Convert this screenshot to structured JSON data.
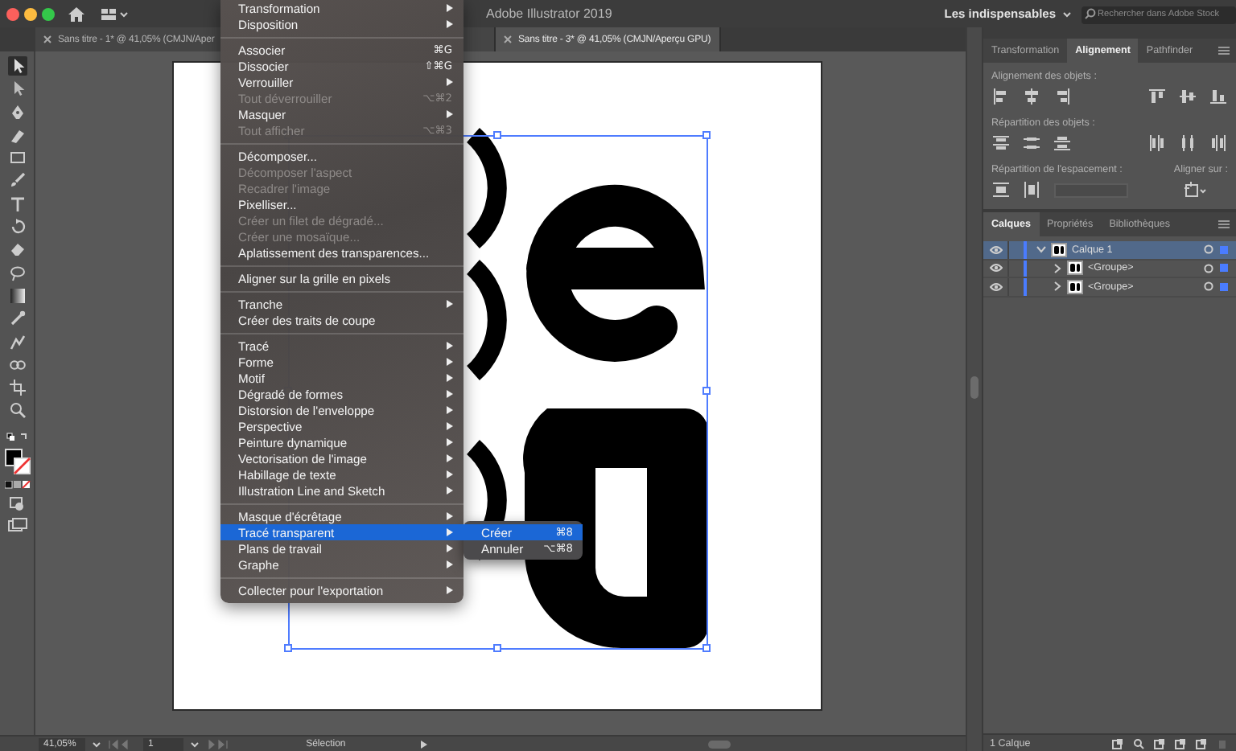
{
  "window": {
    "title": "Adobe Illustrator 2019"
  },
  "workspace": {
    "label": "Les indispensables"
  },
  "stock_search": {
    "placeholder": "Rechercher dans Adobe Stock"
  },
  "document_tabs": [
    {
      "label": "Sans titre - 1* @ 41,05% (CMJN/Aper",
      "selected": false
    },
    {
      "label": "Sans titre - 3* @ 41,05% (CMJN/Aperçu GPU)",
      "selected": true
    }
  ],
  "toolbar": {
    "tools": [
      {
        "kind": "selection",
        "selected": true
      },
      {
        "kind": "direct-selection",
        "selected": false
      },
      {
        "kind": "pen",
        "selected": false
      },
      {
        "kind": "shaper",
        "selected": false
      },
      {
        "kind": "rectangle",
        "selected": false
      },
      {
        "kind": "brush",
        "selected": false
      },
      {
        "kind": "type",
        "selected": false
      },
      {
        "kind": "rotate",
        "selected": false
      },
      {
        "kind": "eraser",
        "selected": false
      },
      {
        "kind": "lasso",
        "selected": false
      },
      {
        "kind": "gradient",
        "selected": false
      },
      {
        "kind": "eyedropper",
        "selected": false
      },
      {
        "kind": "blend",
        "selected": false
      },
      {
        "kind": "symbol",
        "selected": false
      },
      {
        "kind": "artboard",
        "selected": false
      },
      {
        "kind": "zoom",
        "selected": false
      },
      {
        "kind": "swap",
        "selected": false
      },
      {
        "kind": "fill-stroke",
        "selected": false
      },
      {
        "kind": "color-mode",
        "selected": false
      },
      {
        "kind": "draw-mode",
        "selected": false
      },
      {
        "kind": "screen-mode",
        "selected": false
      }
    ]
  },
  "menu": {
    "items": [
      {
        "kind": "item",
        "label": "Transformation",
        "submenu": true,
        "disabled": false,
        "selected": false
      },
      {
        "kind": "item",
        "label": "Disposition",
        "submenu": true,
        "disabled": false,
        "selected": false
      },
      {
        "kind": "separator"
      },
      {
        "kind": "item",
        "label": "Associer",
        "shortcut": "⌘G",
        "submenu": false,
        "disabled": false,
        "selected": false
      },
      {
        "kind": "item",
        "label": "Dissocier",
        "shortcut": "⇧⌘G",
        "submenu": false,
        "disabled": false,
        "selected": false
      },
      {
        "kind": "item",
        "label": "Verrouiller",
        "submenu": true,
        "disabled": false,
        "selected": false
      },
      {
        "kind": "item",
        "label": "Tout déverrouiller",
        "shortcut": "⌥⌘2",
        "submenu": false,
        "disabled": true,
        "selected": false
      },
      {
        "kind": "item",
        "label": "Masquer",
        "submenu": true,
        "disabled": false,
        "selected": false
      },
      {
        "kind": "item",
        "label": "Tout afficher",
        "shortcut": "⌥⌘3",
        "submenu": false,
        "disabled": true,
        "selected": false
      },
      {
        "kind": "separator"
      },
      {
        "kind": "item",
        "label": "Décomposer...",
        "submenu": false,
        "disabled": false,
        "selected": false
      },
      {
        "kind": "item",
        "label": "Décomposer l'aspect",
        "submenu": false,
        "disabled": true,
        "selected": false
      },
      {
        "kind": "item",
        "label": "Recadrer l'image",
        "submenu": false,
        "disabled": true,
        "selected": false
      },
      {
        "kind": "item",
        "label": "Pixelliser...",
        "submenu": false,
        "disabled": false,
        "selected": false
      },
      {
        "kind": "item",
        "label": "Créer un filet de dégradé...",
        "submenu": false,
        "disabled": true,
        "selected": false
      },
      {
        "kind": "item",
        "label": "Créer une mosaïque...",
        "submenu": false,
        "disabled": true,
        "selected": false
      },
      {
        "kind": "item",
        "label": "Aplatissement des transparences...",
        "submenu": false,
        "disabled": false,
        "selected": false
      },
      {
        "kind": "separator"
      },
      {
        "kind": "item",
        "label": "Aligner sur la grille en pixels",
        "submenu": false,
        "disabled": false,
        "selected": false
      },
      {
        "kind": "separator"
      },
      {
        "kind": "item",
        "label": "Tranche",
        "submenu": true,
        "disabled": false,
        "selected": false
      },
      {
        "kind": "item",
        "label": "Créer des traits de coupe",
        "submenu": false,
        "disabled": false,
        "selected": false
      },
      {
        "kind": "separator"
      },
      {
        "kind": "item",
        "label": "Tracé",
        "submenu": true,
        "disabled": false,
        "selected": false
      },
      {
        "kind": "item",
        "label": "Forme",
        "submenu": true,
        "disabled": false,
        "selected": false
      },
      {
        "kind": "item",
        "label": "Motif",
        "submenu": true,
        "disabled": false,
        "selected": false
      },
      {
        "kind": "item",
        "label": "Dégradé de formes",
        "submenu": true,
        "disabled": false,
        "selected": false
      },
      {
        "kind": "item",
        "label": "Distorsion de l'enveloppe",
        "submenu": true,
        "disabled": false,
        "selected": false
      },
      {
        "kind": "item",
        "label": "Perspective",
        "submenu": true,
        "disabled": false,
        "selected": false
      },
      {
        "kind": "item",
        "label": "Peinture dynamique",
        "submenu": true,
        "disabled": false,
        "selected": false
      },
      {
        "kind": "item",
        "label": "Vectorisation de l'image",
        "submenu": true,
        "disabled": false,
        "selected": false
      },
      {
        "kind": "item",
        "label": "Habillage de texte",
        "submenu": true,
        "disabled": false,
        "selected": false
      },
      {
        "kind": "item",
        "label": "Illustration Line and Sketch",
        "submenu": true,
        "disabled": false,
        "selected": false
      },
      {
        "kind": "separator"
      },
      {
        "kind": "item",
        "label": "Masque d'écrêtage",
        "submenu": true,
        "disabled": false,
        "selected": false
      },
      {
        "kind": "item",
        "label": "Tracé transparent",
        "submenu": true,
        "disabled": false,
        "selected": true,
        "submenu_items": [
          {
            "label": "Créer",
            "shortcut": "⌘8",
            "selected": true
          },
          {
            "label": "Annuler",
            "shortcut": "⌥⌘8",
            "selected": false
          }
        ]
      },
      {
        "kind": "item",
        "label": "Plans de travail",
        "submenu": true,
        "disabled": false,
        "selected": false
      },
      {
        "kind": "item",
        "label": "Graphe",
        "submenu": true,
        "disabled": false,
        "selected": false
      },
      {
        "kind": "separator"
      },
      {
        "kind": "item",
        "label": "Collecter pour l'exportation",
        "submenu": true,
        "disabled": false,
        "selected": false
      }
    ]
  },
  "align_panel": {
    "tabs": [
      {
        "label": "Transformation",
        "selected": false
      },
      {
        "label": "Alignement",
        "selected": true
      },
      {
        "label": "Pathfinder",
        "selected": false
      }
    ],
    "sections": [
      "Alignement des objets :",
      "Répartition des objets :",
      "Répartition de l'espacement :"
    ],
    "align_to": "Aligner sur :"
  },
  "layers_panel": {
    "tabs": [
      {
        "label": "Calques",
        "selected": true
      },
      {
        "label": "Propriétés",
        "selected": false
      },
      {
        "label": "Bibliothèques",
        "selected": false
      }
    ],
    "layers": [
      {
        "name": "Calque 1",
        "expanded": true,
        "selected": true,
        "children": [
          {
            "name": "<Groupe>",
            "expanded": false,
            "selected": false
          },
          {
            "name": "<Groupe>",
            "expanded": false,
            "selected": false
          }
        ]
      }
    ],
    "footer": "1 Calque"
  },
  "status_bar": {
    "zoom": "41,05%",
    "artboard_number": "1",
    "current_tool": "Sélection"
  }
}
